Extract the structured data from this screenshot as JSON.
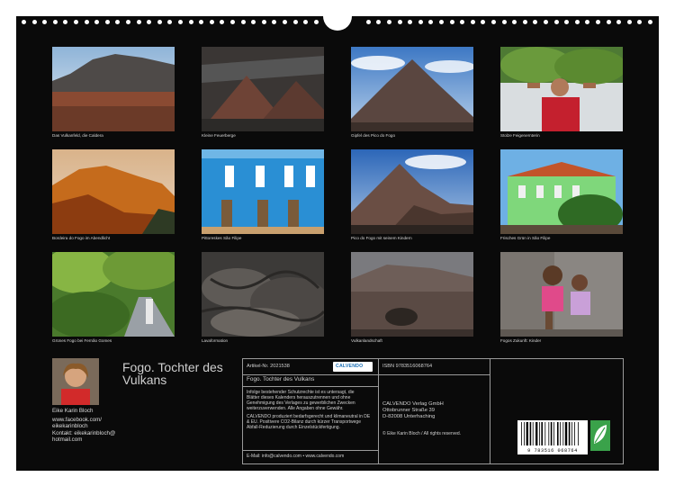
{
  "captions": [
    "Das Vulkanfeld, die Caldera",
    "Kleine Feuerberge",
    "Gipfel des Pico do Fogo",
    "Stolze Feigenernterin",
    "Bordeira do Fogo im Abendlicht",
    "Pittoreskes São Filipe",
    "Pico do Fogo mit seinem Kindern",
    "Frisches Grün in São Filipe",
    "Grünes Fogo bei Fernão Gomes",
    "Lavaformation",
    "Vulkanlandschaft",
    "Fogos Zukunft: Kinder"
  ],
  "title_line1": "Fogo. Tochter des",
  "title_line2": "Vulkans",
  "author": {
    "name": "Eike Karin Bloch",
    "web1": "www.facebook.com/",
    "web2": "eikekarinbloch",
    "contact1": "Kontakt: eikekarinbloch@",
    "contact2": "hotmail.com"
  },
  "info": {
    "article": "Artikel-Nr. 2021538",
    "calvendo_logo": "CALVENDO",
    "isbn": "ISBN 9783516068764",
    "product_title": "Fogo. Tochter des Vulkans",
    "legal1": "Infolge bestehender Schutzrechte ist es untersagt, die",
    "legal2": "Blätter dieses Kalenders herauszutrennen und ohne",
    "legal3": "Genehmigung des Verlages zu gewerblichen Zwecken",
    "legal4": "weiterzuverwenden. Alle Angaben ohne Gewähr.",
    "eco1": "CALVENDO produziert bedarfsgerecht und klimaneutral in DE",
    "eco2": "& EU. Positivere CO2-Bilanz durch kürzer Transportwege",
    "eco3": "Abfall-Reduzierung durch Einzelstückfertigung.",
    "email": "E-Mail: info@calvendo.com • www.calvendo.com",
    "publisher1": "CALVENDO Verlag GmbH",
    "publisher2": "Ottobrunner Straße 39",
    "publisher3": "D-82008 Unterhaching",
    "copyright": "© Eike Karin Bloch / All rights reserved.",
    "barcode": "9 783516 068764"
  }
}
